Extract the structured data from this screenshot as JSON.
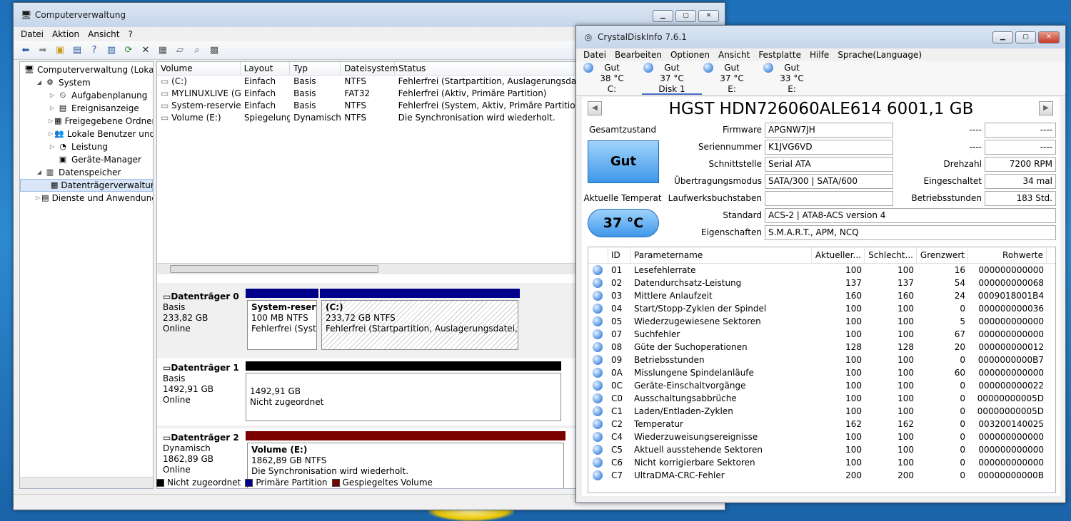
{
  "cv": {
    "title": "Computerverwaltung",
    "menu": [
      "Datei",
      "Aktion",
      "Ansicht",
      "?"
    ],
    "tree": [
      {
        "label": "Computerverwaltung (Lokal)",
        "level": 0,
        "exp": ""
      },
      {
        "label": "System",
        "level": 1,
        "exp": "◢"
      },
      {
        "label": "Aufgabenplanung",
        "level": 2,
        "exp": "▷"
      },
      {
        "label": "Ereignisanzeige",
        "level": 2,
        "exp": "▷"
      },
      {
        "label": "Freigegebene Ordner",
        "level": 2,
        "exp": "▷"
      },
      {
        "label": "Lokale Benutzer und Gruppen",
        "level": 2,
        "exp": "▷"
      },
      {
        "label": "Leistung",
        "level": 2,
        "exp": "▷"
      },
      {
        "label": "Geräte-Manager",
        "level": 2,
        "exp": ""
      },
      {
        "label": "Datenspeicher",
        "level": 1,
        "exp": "◢"
      },
      {
        "label": "Datenträgerverwaltung",
        "level": 2,
        "exp": "",
        "selected": true
      },
      {
        "label": "Dienste und Anwendungen",
        "level": 1,
        "exp": "▷"
      }
    ],
    "vol_headers": [
      "Volume",
      "Layout",
      "Typ",
      "Dateisystem",
      "Status"
    ],
    "volumes": [
      [
        "(C:)",
        "Einfach",
        "Basis",
        "NTFS",
        "Fehlerfrei (Startpartition, Auslagerungsdatei, A"
      ],
      [
        "MYLINUXLIVE (G:)",
        "Einfach",
        "Basis",
        "FAT32",
        "Fehlerfrei (Aktiv, Primäre Partition)"
      ],
      [
        "System-reserviert",
        "Einfach",
        "Basis",
        "NTFS",
        "Fehlerfrei (System, Aktiv, Primäre Partition)"
      ],
      [
        "Volume (E:)",
        "Spiegelung",
        "Dynamisch",
        "NTFS",
        "Die Synchronisation wird wiederholt."
      ]
    ],
    "disks": [
      {
        "name": "Datenträger 0",
        "type": "Basis",
        "size": "233,82 GB",
        "state": "Online",
        "p1_name": "System-reserviert",
        "p1_size": "100 MB NTFS",
        "p1_status": "Fehlerfrei (System",
        "p2_name": "(C:)",
        "p2_size": "233,72 GB NTFS",
        "p2_status": "Fehlerfrei (Startpartition, Auslagerungsdatei, Absturz"
      },
      {
        "name": "Datenträger 1",
        "type": "Basis",
        "size": "1492,91 GB",
        "state": "Online",
        "p1_size": "1492,91 GB",
        "p1_status": "Nicht zugeordnet"
      },
      {
        "name": "Datenträger 2",
        "type": "Dynamisch",
        "size": "1862,89 GB",
        "state": "Online",
        "p1_name": "Volume  (E:)",
        "p1_size": "1862,89 GB NTFS",
        "p1_status": "Die Synchronisation wird wiederholt."
      }
    ],
    "legend": [
      {
        "label": "Nicht zugeordnet",
        "color": "#000000"
      },
      {
        "label": "Primäre Partition",
        "color": "#00008b"
      },
      {
        "label": "Gespiegeltes Volume",
        "color": "#7b0000"
      }
    ]
  },
  "cdi": {
    "title": "CrystalDiskInfo 7.6.1",
    "menu": [
      "Datei",
      "Bearbeiten",
      "Optionen",
      "Ansicht",
      "Festplatte",
      "Hilfe",
      "Sprache(Language)"
    ],
    "drives": [
      {
        "status": "Gut",
        "temp": "38 °C",
        "label": "C:"
      },
      {
        "status": "Gut",
        "temp": "37 °C",
        "label": "Disk 1"
      },
      {
        "status": "Gut",
        "temp": "37 °C",
        "label": "E:"
      },
      {
        "status": "Gut",
        "temp": "33 °C",
        "label": "E:"
      }
    ],
    "model": "HGST HDN726060ALE614 6001,1 GB",
    "health_label": "Gesamtzustand",
    "health": "Gut",
    "temp_label": "Aktuelle Temperat",
    "temp": "37 °C",
    "fields": {
      "firmware_label": "Firmware",
      "firmware": "APGNW7JH",
      "serial_label": "Seriennummer",
      "serial": "K1JVG6VD",
      "interface_label": "Schnittstelle",
      "interface": "Serial ATA",
      "transfer_label": "Übertragungsmodus",
      "transfer": "SATA/300 | SATA/600",
      "letters_label": "Laufwerksbuchstaben",
      "letters": "",
      "standard_label": "Standard",
      "standard": "ACS-2 | ATA8-ACS version 4",
      "features_label": "Eigenschaften",
      "features": "S.M.A.R.T., APM, NCQ",
      "r1_label": "----",
      "r1": "----",
      "r2_label": "----",
      "r2": "----",
      "rpm_label": "Drehzahl",
      "rpm": "7200 RPM",
      "count_label": "Eingeschaltet",
      "count": "34 mal",
      "hours_label": "Betriebsstunden",
      "hours": "183 Std."
    },
    "smart_headers": [
      "ID",
      "Parametername",
      "Aktueller...",
      "Schlecht...",
      "Grenzwert",
      "Rohwerte"
    ],
    "smart": [
      [
        "01",
        "Lesefehlerrate",
        "100",
        "100",
        "16",
        "000000000000"
      ],
      [
        "02",
        "Datendurchsatz-Leistung",
        "137",
        "137",
        "54",
        "000000000068"
      ],
      [
        "03",
        "Mittlere Anlaufzeit",
        "160",
        "160",
        "24",
        "0009018001B4"
      ],
      [
        "04",
        "Start/Stopp-Zyklen der Spindel",
        "100",
        "100",
        "0",
        "000000000036"
      ],
      [
        "05",
        "Wiederzugewiesene Sektoren",
        "100",
        "100",
        "5",
        "000000000000"
      ],
      [
        "07",
        "Suchfehler",
        "100",
        "100",
        "67",
        "000000000000"
      ],
      [
        "08",
        "Güte der Suchoperationen",
        "128",
        "128",
        "20",
        "000000000012"
      ],
      [
        "09",
        "Betriebsstunden",
        "100",
        "100",
        "0",
        "0000000000B7"
      ],
      [
        "0A",
        "Misslungene Spindelanläufe",
        "100",
        "100",
        "60",
        "000000000000"
      ],
      [
        "0C",
        "Geräte-Einschaltvorgänge",
        "100",
        "100",
        "0",
        "000000000022"
      ],
      [
        "C0",
        "Ausschaltungsabbrüche",
        "100",
        "100",
        "0",
        "00000000005D"
      ],
      [
        "C1",
        "Laden/Entladen-Zyklen",
        "100",
        "100",
        "0",
        "00000000005D"
      ],
      [
        "C2",
        "Temperatur",
        "162",
        "162",
        "0",
        "003200140025"
      ],
      [
        "C4",
        "Wiederzuweisungsereignisse",
        "100",
        "100",
        "0",
        "000000000000"
      ],
      [
        "C5",
        "Aktuell ausstehende Sektoren",
        "100",
        "100",
        "0",
        "000000000000"
      ],
      [
        "C6",
        "Nicht korrigierbare Sektoren",
        "100",
        "100",
        "0",
        "000000000000"
      ],
      [
        "C7",
        "UltraDMA-CRC-Fehler",
        "200",
        "200",
        "0",
        "00000000000B"
      ]
    ]
  }
}
